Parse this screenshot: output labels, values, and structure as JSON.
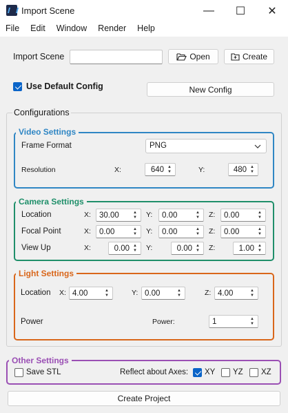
{
  "window": {
    "title": "Import Scene",
    "minimize_glyph": "—",
    "maximize_glyph": "☐",
    "close_glyph": "✕",
    "icon": "app-icon"
  },
  "menu": [
    "File",
    "Edit",
    "Window",
    "Render",
    "Help"
  ],
  "import": {
    "label": "Import Scene",
    "path_value": "",
    "open_label": "Open",
    "create_label": "Create"
  },
  "default_config": {
    "label": "Use Default Config",
    "checked": true
  },
  "new_config_label": "New Config",
  "configurations_label": "Configurations",
  "video": {
    "title": "Video Settings",
    "frame_format_label": "Frame Format",
    "frame_format_value": "PNG",
    "resolution_label": "Resolution",
    "x_label": "X:",
    "x_value": "640",
    "y_label": "Y:",
    "y_value": "480"
  },
  "camera": {
    "title": "Camera Settings",
    "rows": [
      {
        "label": "Location",
        "x": "30.00",
        "y": "0.00",
        "z": "0.00"
      },
      {
        "label": "Focal Point",
        "x": "0.00",
        "y": "0.00",
        "z": "0.00"
      },
      {
        "label": "View Up",
        "x": "0.00",
        "y": "0.00",
        "z": "1.00"
      }
    ],
    "x_label": "X:",
    "y_label": "Y:",
    "z_label": "Z:"
  },
  "light": {
    "title": "Light Settings",
    "location_label": "Location",
    "x_label": "X:",
    "x": "4.00",
    "y_label": "Y:",
    "y": "0.00",
    "z_label": "Z:",
    "z": "4.00",
    "power_label": "Power",
    "power_sub_label": "Power:",
    "power_value": "1"
  },
  "other": {
    "title": "Other Settings",
    "save_stl_label": "Save STL",
    "reflect_label": "Reflect about Axes:",
    "xy_label": "XY",
    "xy_checked": true,
    "yz_label": "YZ",
    "yz_checked": false,
    "xz_label": "XZ",
    "xz_checked": false
  },
  "create_project_label": "Create Project",
  "colors": {
    "video": "#2f86c4",
    "camera": "#1f8f6a",
    "light": "#d9661a",
    "other": "#9a4fb4",
    "check": "#0a64c8"
  }
}
